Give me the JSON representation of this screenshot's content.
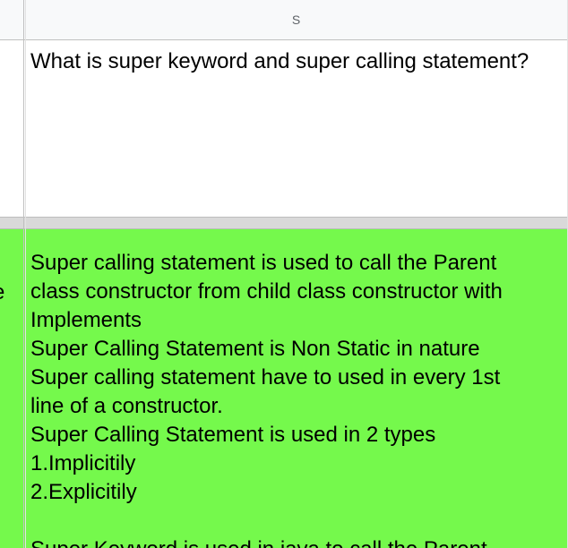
{
  "sheet": {
    "column_header": "S",
    "question": "What is super keyword and super calling statement?",
    "left_cell_fragment": "e",
    "answer_lines": [
      "Super calling statement is used to call the Parent",
      "class constructor from child class constructor with",
      "Implements",
      "Super Calling Statement is Non Static in nature",
      "Super calling statement have to used in every 1st",
      "line of a constructor.",
      "Super Calling Statement is used in 2 types",
      "1.Implicitily",
      "2.Explicitily",
      "",
      "Super Keyword is used in java to call the Parent"
    ],
    "answer_fill_color": "#75f94c"
  }
}
